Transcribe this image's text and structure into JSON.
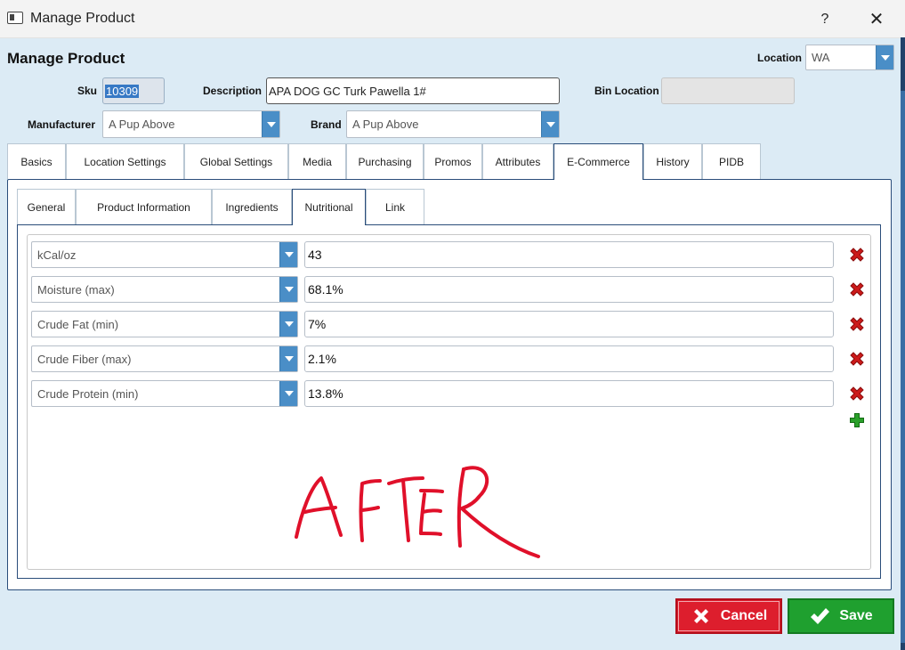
{
  "window": {
    "title": "Manage Product",
    "help": "?",
    "close": "✕"
  },
  "header": {
    "title": "Manage Product",
    "location_label": "Location",
    "location_value": "WA",
    "sku_label": "Sku",
    "sku_value": "10309",
    "description_label": "Description",
    "description_value": "APA DOG GC Turk Pawella 1#",
    "bin_location_label": "Bin Location",
    "bin_location_value": "",
    "manufacturer_label": "Manufacturer",
    "manufacturer_value": "A Pup Above",
    "brand_label": "Brand",
    "brand_value": "A Pup Above"
  },
  "tabs": [
    {
      "label": "Basics"
    },
    {
      "label": "Location Settings"
    },
    {
      "label": "Global Settings"
    },
    {
      "label": "Media"
    },
    {
      "label": "Purchasing"
    },
    {
      "label": "Promos"
    },
    {
      "label": "Attributes"
    },
    {
      "label": "E-Commerce",
      "active": true
    },
    {
      "label": "History"
    },
    {
      "label": "PIDB"
    }
  ],
  "subtabs": [
    {
      "label": "General"
    },
    {
      "label": "Product Information"
    },
    {
      "label": "Ingredients"
    },
    {
      "label": "Nutritional",
      "active": true
    },
    {
      "label": "Link"
    }
  ],
  "nutritional": [
    {
      "name": "kCal/oz",
      "value": "43"
    },
    {
      "name": "Moisture (max)",
      "value": "68.1%"
    },
    {
      "name": "Crude Fat (min)",
      "value": "7%"
    },
    {
      "name": "Crude Fiber (max)",
      "value": "2.1%"
    },
    {
      "name": "Crude Protein (min)",
      "value": "13.8%"
    }
  ],
  "annotation": "AFTER",
  "buttons": {
    "cancel": "Cancel",
    "save": "Save"
  },
  "colors": {
    "accent": "#4a8ec7",
    "cancel": "#dd1e2d",
    "save": "#1fa02f",
    "annotation": "#e0102a",
    "delete": "#cc1a1a",
    "add": "#2aa02a"
  }
}
